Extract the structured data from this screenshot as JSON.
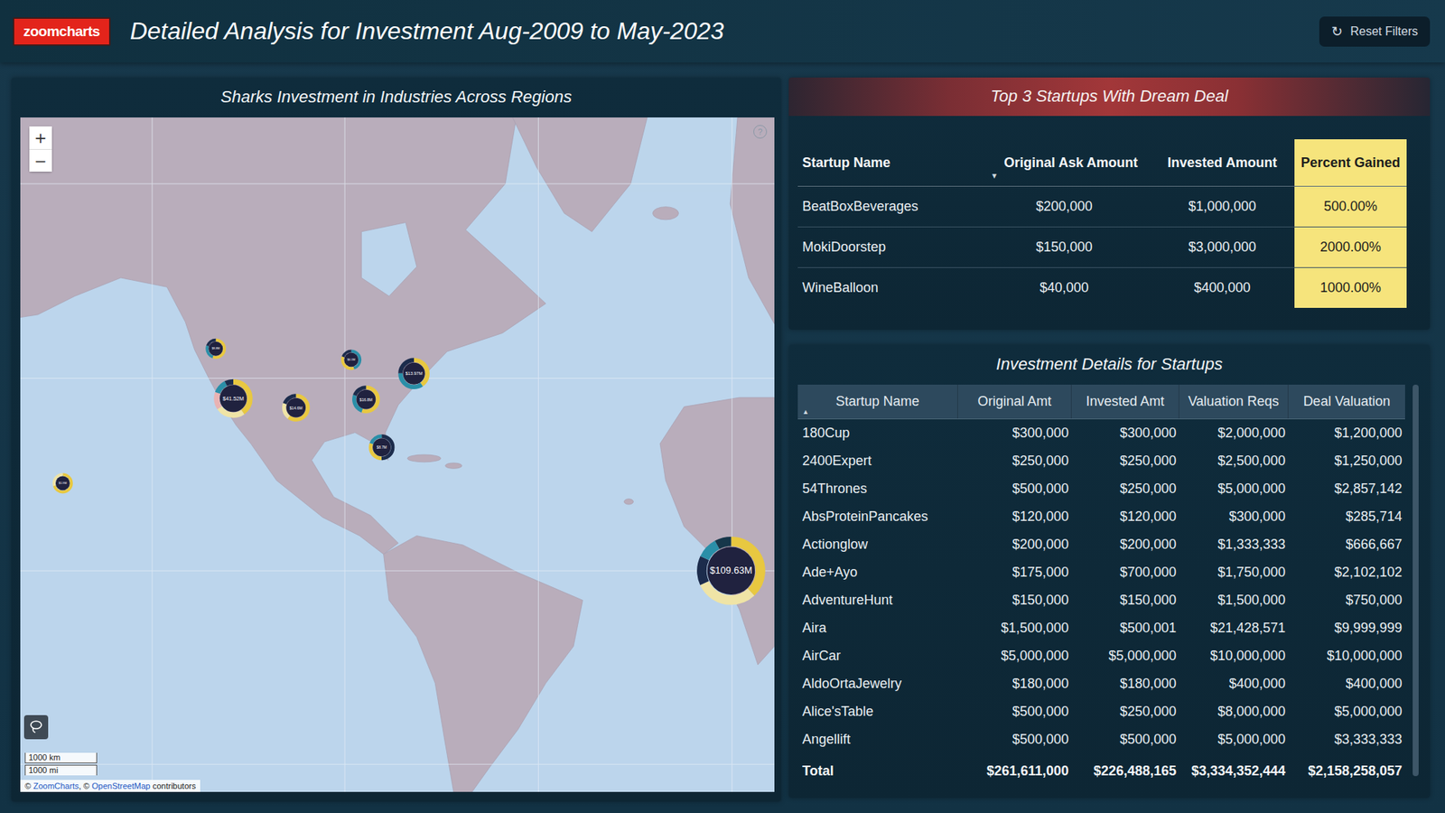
{
  "header": {
    "logo": "zoomcharts",
    "title": "Detailed Analysis for Investment Aug-2009 to May-2023",
    "reset_button": {
      "icon": "↻",
      "label": "Reset Filters"
    }
  },
  "map_panel": {
    "title": "Sharks Investment in Industries Across Regions",
    "controls": {
      "zoom_in": "+",
      "zoom_out": "−",
      "help": "?"
    },
    "scale": [
      "1000 km",
      "1000 mi"
    ],
    "attribution": [
      {
        "text": "© ",
        "link": false
      },
      {
        "text": "ZoomCharts",
        "link": true
      },
      {
        "text": ", © ",
        "link": false
      },
      {
        "text": "OpenStreetMap",
        "link": true
      },
      {
        "text": " contributors",
        "link": false
      }
    ],
    "pins": [
      {
        "label": "$8.8M",
        "segments": [
          {
            "value": 55,
            "color": "#e8c840"
          },
          {
            "value": 25,
            "color": "#2a8fa8"
          },
          {
            "value": 20,
            "color": "#1c2c4c"
          }
        ]
      },
      {
        "label": "$41.52M",
        "segments": [
          {
            "value": 40,
            "color": "#e8c840"
          },
          {
            "value": 25,
            "color": "#efe4a6"
          },
          {
            "value": 15,
            "color": "#e9b3b3"
          },
          {
            "value": 12,
            "color": "#2a8fa8"
          },
          {
            "value": 8,
            "color": "#1c2c4c"
          }
        ]
      },
      {
        "label": "$4.1M",
        "segments": [
          {
            "value": 45,
            "color": "#2a8fa8"
          },
          {
            "value": 35,
            "color": "#e8c840"
          },
          {
            "value": 20,
            "color": "#1c2c4c"
          }
        ]
      },
      {
        "label": "$13.97M",
        "segments": [
          {
            "value": 40,
            "color": "#e8c840"
          },
          {
            "value": 35,
            "color": "#2a8fa8"
          },
          {
            "value": 25,
            "color": "#1c2c4c"
          }
        ]
      },
      {
        "label": "$14.6M",
        "segments": [
          {
            "value": 60,
            "color": "#e8c840"
          },
          {
            "value": 20,
            "color": "#efe4a6"
          },
          {
            "value": 20,
            "color": "#1c2c4c"
          }
        ]
      },
      {
        "label": "$16.8M",
        "segments": [
          {
            "value": 55,
            "color": "#e8c840"
          },
          {
            "value": 25,
            "color": "#2a8fa8"
          },
          {
            "value": 20,
            "color": "#1c2c4c"
          }
        ]
      },
      {
        "label": "$8.7M",
        "segments": [
          {
            "value": 50,
            "color": "#1c2c4c"
          },
          {
            "value": 30,
            "color": "#e8c840"
          },
          {
            "value": 20,
            "color": "#2a8fa8"
          }
        ]
      },
      {
        "label": "$1.9M",
        "segments": [
          {
            "value": 70,
            "color": "#e8c840"
          },
          {
            "value": 30,
            "color": "#efe4a6"
          }
        ]
      },
      {
        "label": "$109.63M",
        "segments": [
          {
            "value": 38,
            "color": "#e8c840"
          },
          {
            "value": 30,
            "color": "#efe4a6"
          },
          {
            "value": 14,
            "color": "#1c2c4c"
          },
          {
            "value": 10,
            "color": "#2a8fa8"
          },
          {
            "value": 8,
            "color": "#16374a"
          }
        ]
      }
    ]
  },
  "top_deals": {
    "title": "Top 3 Startups With Dream Deal",
    "columns": [
      {
        "label": "Startup Name",
        "sort": "",
        "highlighted": false
      },
      {
        "label": "Original Ask Amount",
        "sort": "▼",
        "highlighted": false
      },
      {
        "label": "Invested Amount",
        "sort": "",
        "highlighted": false
      },
      {
        "label": "Percent Gained",
        "sort": "",
        "highlighted": true
      }
    ],
    "rows": [
      [
        "BeatBoxBeverages",
        "$200,000",
        "$1,000,000",
        "500.00%"
      ],
      [
        "MokiDoorstep",
        "$150,000",
        "$3,000,000",
        "2000.00%"
      ],
      [
        "WineBalloon",
        "$40,000",
        "$400,000",
        "1000.00%"
      ]
    ]
  },
  "details": {
    "title": "Investment Details for Startups",
    "columns": [
      {
        "label": "Startup Name",
        "sort": "▲"
      },
      {
        "label": "Original Amt",
        "sort": ""
      },
      {
        "label": "Invested Amt",
        "sort": ""
      },
      {
        "label": "Valuation Reqs",
        "sort": ""
      },
      {
        "label": "Deal Valuation",
        "sort": ""
      }
    ],
    "rows": [
      [
        "180Cup",
        "$300,000",
        "$300,000",
        "$2,000,000",
        "$1,200,000"
      ],
      [
        "2400Expert",
        "$250,000",
        "$250,000",
        "$2,500,000",
        "$1,250,000"
      ],
      [
        "54Thrones",
        "$500,000",
        "$250,000",
        "$5,000,000",
        "$2,857,142"
      ],
      [
        "AbsProteinPancakes",
        "$120,000",
        "$120,000",
        "$300,000",
        "$285,714"
      ],
      [
        "Actionglow",
        "$200,000",
        "$200,000",
        "$1,333,333",
        "$666,667"
      ],
      [
        "Ade+Ayo",
        "$175,000",
        "$700,000",
        "$1,750,000",
        "$2,102,102"
      ],
      [
        "AdventureHunt",
        "$150,000",
        "$150,000",
        "$1,500,000",
        "$750,000"
      ],
      [
        "Aira",
        "$1,500,000",
        "$500,001",
        "$21,428,571",
        "$9,999,999"
      ],
      [
        "AirCar",
        "$5,000,000",
        "$5,000,000",
        "$10,000,000",
        "$10,000,000"
      ],
      [
        "AldoOrtaJewelry",
        "$180,000",
        "$180,000",
        "$400,000",
        "$400,000"
      ],
      [
        "Alice'sTable",
        "$500,000",
        "$250,000",
        "$8,000,000",
        "$5,000,000"
      ],
      [
        "Angellift",
        "$500,000",
        "$500,000",
        "$5,000,000",
        "$3,333,333"
      ]
    ],
    "total": [
      "Total",
      "$261,611,000",
      "$226,488,165",
      "$3,334,352,444",
      "$2,158,258,057"
    ]
  }
}
